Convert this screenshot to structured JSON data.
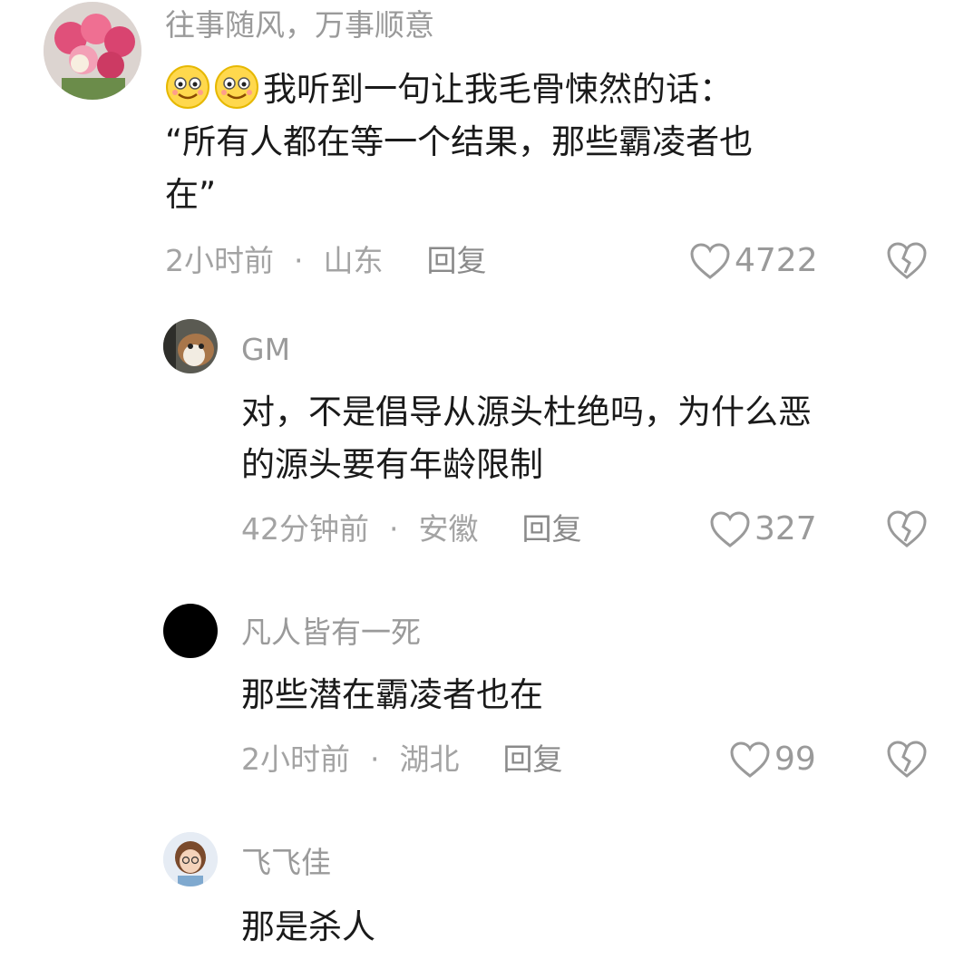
{
  "comments": [
    {
      "username": "往事随风，万事顺意",
      "text_line1": "我听到一句让我毛骨悚然的话：",
      "text_line2": "“所有人都在等一个结果，那些霸凌者也",
      "text_line3": "在”",
      "time": "2小时前",
      "location": "山东",
      "reply": "回复",
      "likes": "4722",
      "emojis": [
        "smiling-face-icon",
        "smiling-face-icon"
      ]
    },
    {
      "username": "GM",
      "text_line1": "对，不是倡导从源头杜绝吗，为什么恶",
      "text_line2": "的源头要有年龄限制",
      "time": "42分钟前",
      "location": "安徽",
      "reply": "回复",
      "likes": "327"
    },
    {
      "username": "凡人皆有一死",
      "text_line1": "那些潜在霸凌者也在",
      "time": "2小时前",
      "location": "湖北",
      "reply": "回复",
      "likes": "99"
    },
    {
      "username": "飞飞佳",
      "text_line1": "那是杀人"
    }
  ],
  "separator": "·",
  "colors": {
    "text": "#1a1a1a",
    "muted": "#9a9a9a",
    "background": "#ffffff"
  }
}
